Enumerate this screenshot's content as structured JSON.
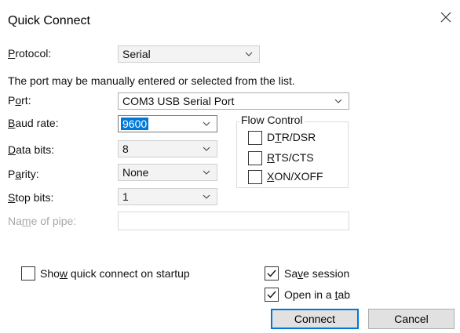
{
  "window": {
    "title": "Quick Connect"
  },
  "protocol": {
    "label_pre": "",
    "label_key": "P",
    "label_post": "rotocol:",
    "value": "Serial"
  },
  "instruction": "The port may be manually entered or selected from the list.",
  "port": {
    "label_pre": "P",
    "label_key": "o",
    "label_post": "rt:",
    "value": "COM3 USB Serial Port"
  },
  "baud_rate": {
    "label_pre": "",
    "label_key": "B",
    "label_post": "aud rate:",
    "value": "9600"
  },
  "data_bits": {
    "label_pre": "",
    "label_key": "D",
    "label_post": "ata bits:",
    "value": "8"
  },
  "parity": {
    "label_pre": "P",
    "label_key": "a",
    "label_post": "rity:",
    "value": "None"
  },
  "stop_bits": {
    "label_pre": "",
    "label_key": "S",
    "label_post": "top bits:",
    "value": "1"
  },
  "pipe": {
    "label_pre": "Na",
    "label_key": "m",
    "label_post": "e of pipe:",
    "value": ""
  },
  "flow_control": {
    "title": "Flow Control",
    "options": [
      {
        "pre": "D",
        "key": "T",
        "post": "R/DSR",
        "checked": false
      },
      {
        "pre": "",
        "key": "R",
        "post": "TS/CTS",
        "checked": false
      },
      {
        "pre": "",
        "key": "X",
        "post": "ON/XOFF",
        "checked": false
      }
    ]
  },
  "show_quick_connect": {
    "pre": "Sho",
    "key": "w",
    "post": " quick connect on startup",
    "checked": false
  },
  "save_session": {
    "pre": "Sa",
    "key": "v",
    "post": "e session",
    "checked": true
  },
  "open_in_tab": {
    "pre": "Open in a ",
    "key": "t",
    "post": "ab",
    "checked": true
  },
  "buttons": {
    "connect": "Connect",
    "cancel": "Cancel"
  },
  "colors": {
    "accent": "#0078d7",
    "button_bg": "#e1e1e1",
    "disabled_text": "#a8a8a8"
  }
}
